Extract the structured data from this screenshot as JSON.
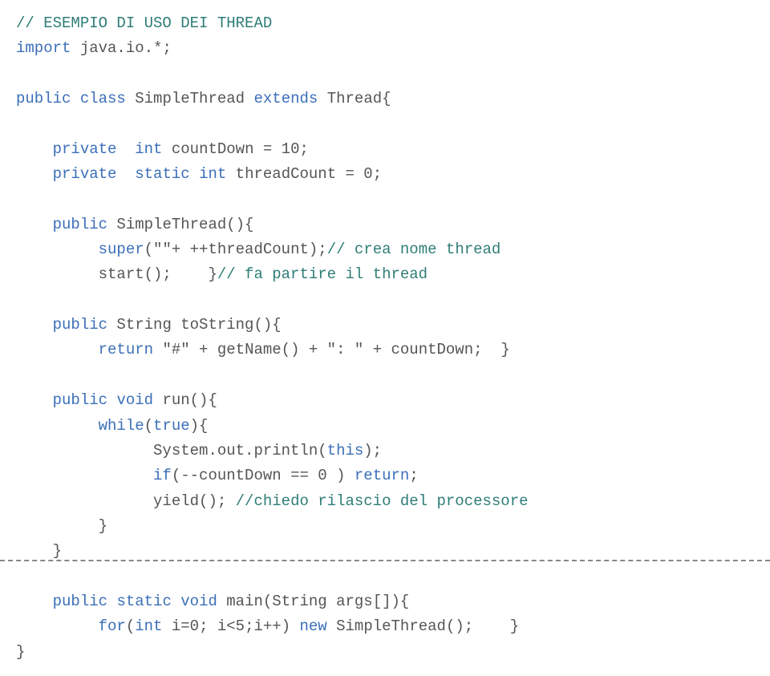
{
  "lines": [
    {
      "segments": [
        {
          "cls": "teal",
          "text": "// ESEMPIO DI USO DEI THREAD"
        }
      ]
    },
    {
      "segments": [
        {
          "cls": "blue",
          "text": "import"
        },
        {
          "cls": "gray",
          "text": " java.io.*;"
        }
      ]
    },
    {
      "segments": [
        {
          "cls": "gray",
          "text": ""
        }
      ]
    },
    {
      "segments": [
        {
          "cls": "blue",
          "text": "public"
        },
        {
          "cls": "gray",
          "text": " "
        },
        {
          "cls": "blue",
          "text": "class"
        },
        {
          "cls": "gray",
          "text": " SimpleThread "
        },
        {
          "cls": "blue",
          "text": "extends"
        },
        {
          "cls": "gray",
          "text": " Thread{"
        }
      ]
    },
    {
      "segments": [
        {
          "cls": "gray",
          "text": ""
        }
      ]
    },
    {
      "segments": [
        {
          "cls": "gray",
          "text": "    "
        },
        {
          "cls": "blue",
          "text": "private"
        },
        {
          "cls": "gray",
          "text": "  "
        },
        {
          "cls": "blue",
          "text": "int"
        },
        {
          "cls": "gray",
          "text": " countDown = 10;"
        }
      ]
    },
    {
      "segments": [
        {
          "cls": "gray",
          "text": "    "
        },
        {
          "cls": "blue",
          "text": "private"
        },
        {
          "cls": "gray",
          "text": "  "
        },
        {
          "cls": "blue",
          "text": "static int"
        },
        {
          "cls": "gray",
          "text": " threadCount = 0;"
        }
      ]
    },
    {
      "segments": [
        {
          "cls": "gray",
          "text": ""
        }
      ]
    },
    {
      "segments": [
        {
          "cls": "gray",
          "text": "    "
        },
        {
          "cls": "blue",
          "text": "public"
        },
        {
          "cls": "gray",
          "text": " SimpleThread(){"
        }
      ]
    },
    {
      "segments": [
        {
          "cls": "gray",
          "text": "         "
        },
        {
          "cls": "blue",
          "text": "super"
        },
        {
          "cls": "gray",
          "text": "(\"\"+ ++threadCount);"
        },
        {
          "cls": "teal",
          "text": "// crea nome thread"
        }
      ]
    },
    {
      "segments": [
        {
          "cls": "gray",
          "text": "         start();    }"
        },
        {
          "cls": "teal",
          "text": "// fa partire il thread"
        }
      ]
    },
    {
      "segments": [
        {
          "cls": "gray",
          "text": ""
        }
      ]
    },
    {
      "segments": [
        {
          "cls": "gray",
          "text": "    "
        },
        {
          "cls": "blue",
          "text": "public"
        },
        {
          "cls": "gray",
          "text": " String toString(){"
        }
      ]
    },
    {
      "segments": [
        {
          "cls": "gray",
          "text": "         "
        },
        {
          "cls": "blue",
          "text": "return"
        },
        {
          "cls": "gray",
          "text": " \"#\" + getName() + \": \" + countDown;  }"
        }
      ]
    },
    {
      "segments": [
        {
          "cls": "gray",
          "text": ""
        }
      ]
    },
    {
      "segments": [
        {
          "cls": "gray",
          "text": "    "
        },
        {
          "cls": "blue",
          "text": "public"
        },
        {
          "cls": "gray",
          "text": " "
        },
        {
          "cls": "blue",
          "text": "void"
        },
        {
          "cls": "gray",
          "text": " run(){"
        }
      ]
    },
    {
      "segments": [
        {
          "cls": "gray",
          "text": "         "
        },
        {
          "cls": "blue",
          "text": "while"
        },
        {
          "cls": "gray",
          "text": "("
        },
        {
          "cls": "blue",
          "text": "true"
        },
        {
          "cls": "gray",
          "text": "){"
        }
      ]
    },
    {
      "segments": [
        {
          "cls": "gray",
          "text": "               System.out.println("
        },
        {
          "cls": "blue",
          "text": "this"
        },
        {
          "cls": "gray",
          "text": ");"
        }
      ]
    },
    {
      "segments": [
        {
          "cls": "gray",
          "text": "               "
        },
        {
          "cls": "blue",
          "text": "if"
        },
        {
          "cls": "gray",
          "text": "(--countDown == 0 ) "
        },
        {
          "cls": "blue",
          "text": "return"
        },
        {
          "cls": "gray",
          "text": ";"
        }
      ]
    },
    {
      "segments": [
        {
          "cls": "gray",
          "text": "               yield(); "
        },
        {
          "cls": "teal",
          "text": "//chiedo rilascio del processore"
        }
      ]
    },
    {
      "segments": [
        {
          "cls": "gray",
          "text": "         }"
        }
      ]
    },
    {
      "segments": [
        {
          "cls": "gray",
          "text": "    }"
        }
      ]
    },
    {
      "segments": [
        {
          "cls": "gray",
          "text": ""
        }
      ]
    },
    {
      "segments": [
        {
          "cls": "gray",
          "text": "    "
        },
        {
          "cls": "blue",
          "text": "public"
        },
        {
          "cls": "gray",
          "text": " "
        },
        {
          "cls": "blue",
          "text": "static"
        },
        {
          "cls": "gray",
          "text": " "
        },
        {
          "cls": "blue",
          "text": "void"
        },
        {
          "cls": "gray",
          "text": " main(String args[]){"
        }
      ]
    },
    {
      "segments": [
        {
          "cls": "gray",
          "text": "         "
        },
        {
          "cls": "blue",
          "text": "for"
        },
        {
          "cls": "gray",
          "text": "("
        },
        {
          "cls": "blue",
          "text": "int"
        },
        {
          "cls": "gray",
          "text": " i=0; i<5;i++) "
        },
        {
          "cls": "blue",
          "text": "new"
        },
        {
          "cls": "gray",
          "text": " SimpleThread();    }"
        }
      ]
    },
    {
      "segments": [
        {
          "cls": "gray",
          "text": "}"
        }
      ]
    }
  ]
}
